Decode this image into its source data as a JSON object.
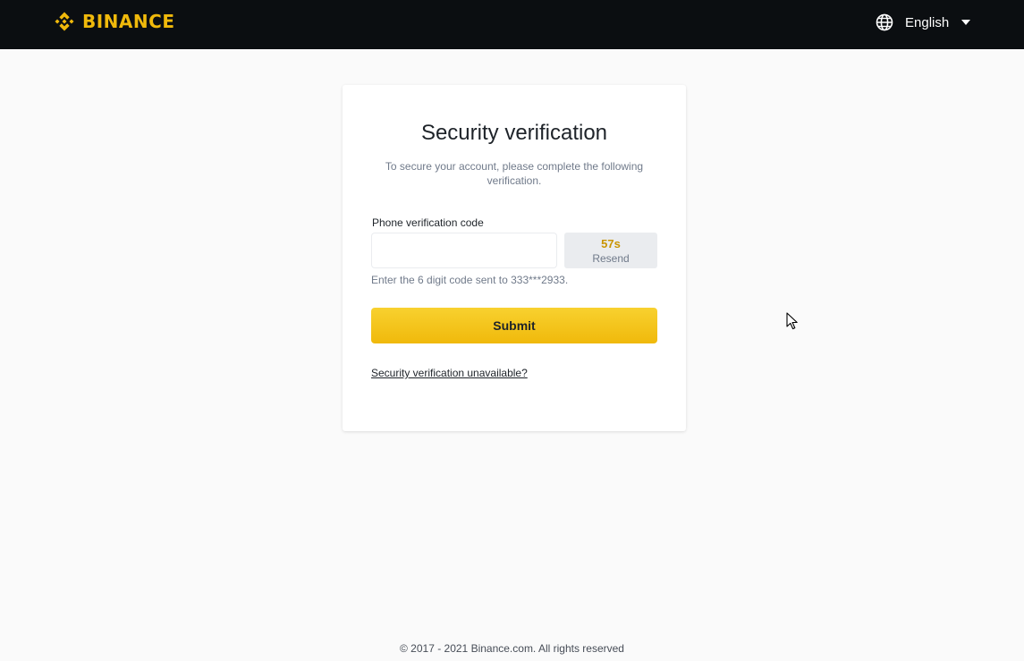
{
  "header": {
    "brand": "BINANCE",
    "brand_color": "#f0b90b",
    "language_icon": "globe-icon",
    "language": "English",
    "language_menu_icon": "caret-down-icon"
  },
  "card": {
    "title": "Security verification",
    "subtitle": "To secure your account, please complete the following verification.",
    "phone_field": {
      "label": "Phone verification code",
      "value": "",
      "placeholder": ""
    },
    "resend": {
      "countdown": "57s",
      "label": "Resend"
    },
    "hint": "Enter the 6 digit code sent to 333***2933.",
    "submit_label": "Submit",
    "unavailable_link": "Security verification unavailable?"
  },
  "footer": {
    "copyright": "© 2017 - 2021 Binance.com. All rights reserved"
  },
  "colors": {
    "topbar": "#0b0e11",
    "accent": "#f0b90b",
    "timer": "#c99400",
    "page_background": "#fafafa"
  }
}
